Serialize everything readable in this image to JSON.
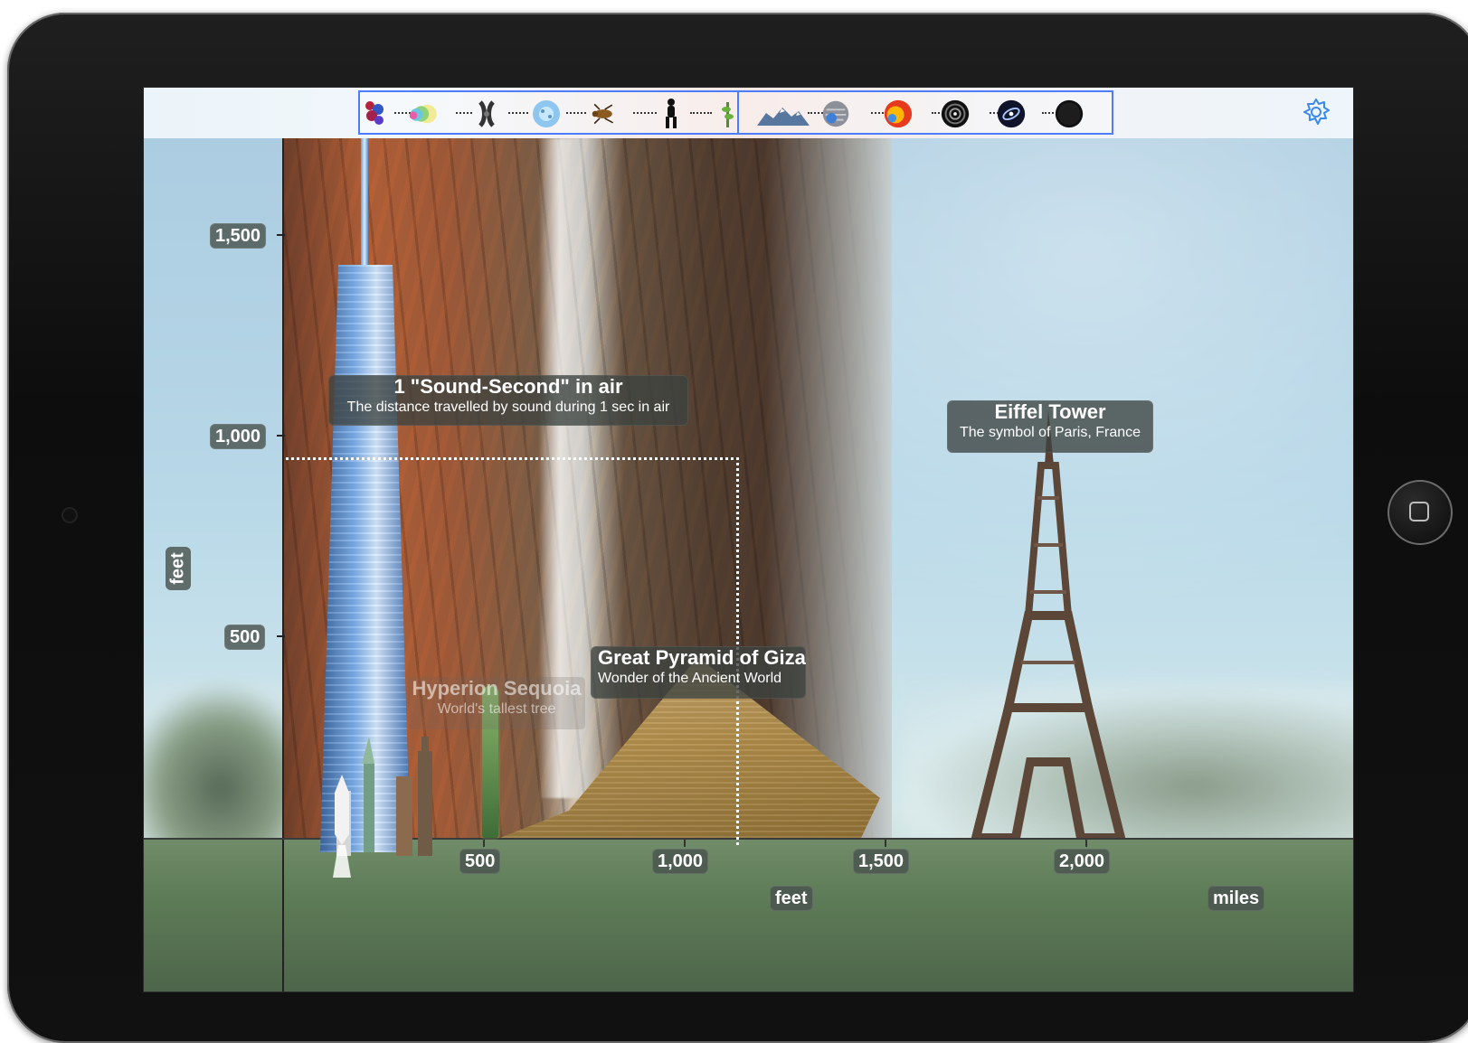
{
  "axis": {
    "y_unit": "feet",
    "y_ticks": [
      "1,500",
      "1,000",
      "500"
    ],
    "x_ticks": [
      "500",
      "1,000",
      "1,500",
      "2,000"
    ],
    "x_unit": "feet",
    "secondary_unit": "miles"
  },
  "objects": {
    "sound_second": {
      "title": "1 \"Sound-Second\" in air",
      "subtitle": "The distance travelled by sound during 1 sec in air"
    },
    "sequoia": {
      "title": "Hyperion Sequoia",
      "subtitle": "World's tallest tree"
    },
    "pyramid": {
      "title": "Great Pyramid of Giza",
      "subtitle": "Wonder of the Ancient World"
    },
    "eiffel": {
      "title": "Eiffel Tower",
      "subtitle": "The symbol of Paris, France"
    }
  },
  "icons": {
    "settings": "gear-icon",
    "scale_strip": [
      "molecule-icon",
      "cell-icon",
      "chromosome-icon",
      "blood-cell-icon",
      "insect-icon",
      "person-icon",
      "plant-icon",
      "mountain-icon",
      "planet-icon",
      "sun-icon",
      "spiral-galaxy-icon",
      "galaxy-icon",
      "black-hole-icon"
    ]
  },
  "colors": {
    "accent": "#4d7cff",
    "label_bg": "#3c4240",
    "ground": "#5f7d58"
  }
}
